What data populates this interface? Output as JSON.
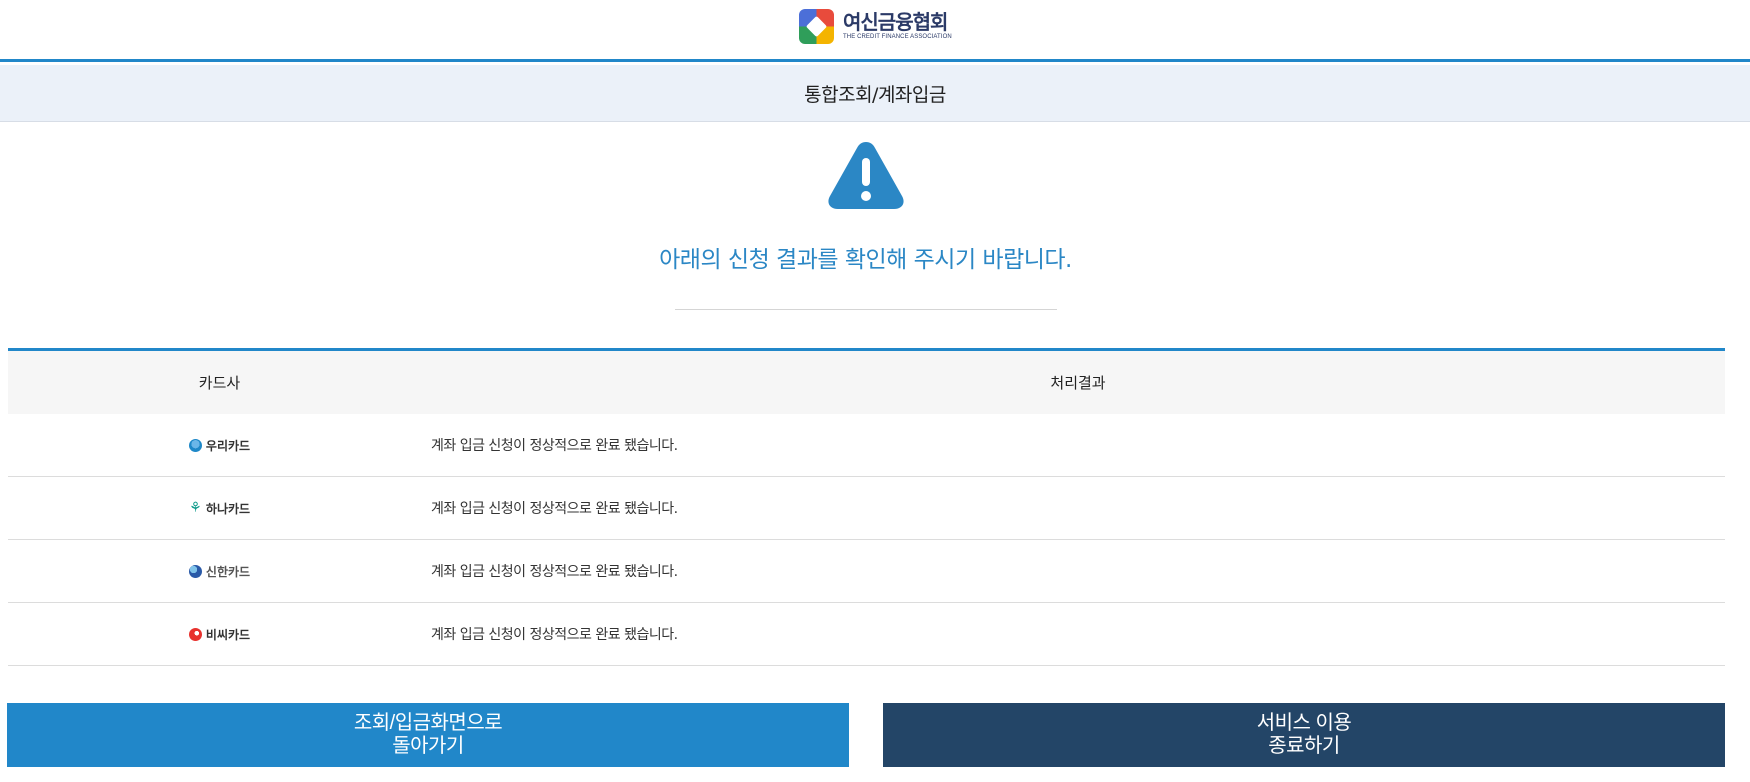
{
  "header": {
    "logo_ko": "여신금융협회",
    "logo_en": "THE CREDIT FINANCE ASSOCIATION"
  },
  "title": "통합조회/계좌입금",
  "warning_icon": "alert-triangle-icon",
  "message": "아래의 신청 결과를 확인해 주시기 바랍니다.",
  "table": {
    "headers": {
      "card": "카드사",
      "result": "처리결과"
    },
    "rows": [
      {
        "card": "우리카드",
        "icon": "woori-card-logo",
        "color": "#1e88c8",
        "result": "계좌 입금 신청이 정상적으로 완료 됐습니다."
      },
      {
        "card": "하나카드",
        "icon": "hana-card-logo",
        "color": "#0d9a8a",
        "result": "계좌 입금 신청이 정상적으로 완료 됐습니다."
      },
      {
        "card": "신한카드",
        "icon": "shinhan-card-logo",
        "color": "#2a5aa8",
        "result": "계좌 입금 신청이 정상적으로 완료 됐습니다."
      },
      {
        "card": "비씨카드",
        "icon": "bc-card-logo",
        "color": "#e8322e",
        "result": "계좌 입금 신청이 정상적으로 완료 됐습니다."
      }
    ]
  },
  "buttons": {
    "back_line1": "조회/입금화면으로",
    "back_line2": "돌아가기",
    "exit_line1": "서비스 이용",
    "exit_line2": "종료하기"
  },
  "colors": {
    "accent": "#2187c9",
    "dark": "#234567",
    "title_bg": "#ebf1f9"
  }
}
